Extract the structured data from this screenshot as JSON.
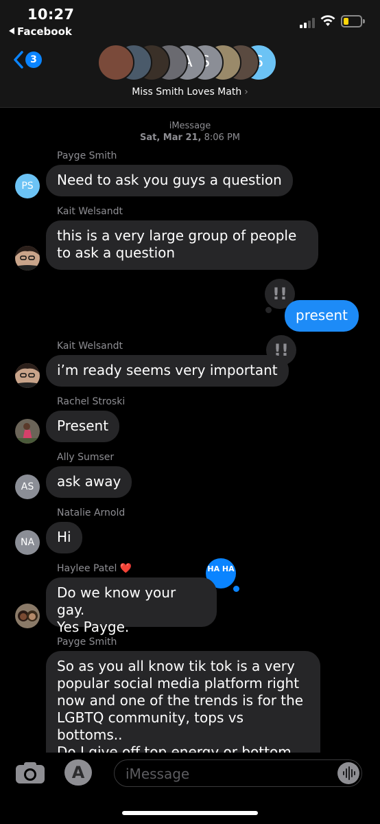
{
  "status_bar": {
    "time": "10:27",
    "back_app": "Facebook",
    "battery_color": "#ffd60a"
  },
  "nav": {
    "unread_count": "3",
    "group_name": "Miss Smith Loves Math",
    "group_chevron": "›",
    "group_avatars": [
      {
        "initials": "",
        "color": "#7a4a3a"
      },
      {
        "initials": "",
        "color": "#4a5a6a"
      },
      {
        "initials": "",
        "color": "#3a3028"
      },
      {
        "initials": "",
        "color": "#6a6a70"
      },
      {
        "initials": "A",
        "color": "#8b8e96"
      },
      {
        "initials": "S",
        "color": "#8b8e96"
      },
      {
        "initials": "",
        "color": "#9a8a6a"
      },
      {
        "initials": "",
        "color": "#5a4a40"
      },
      {
        "initials": "S",
        "color": "#6cc3f5"
      }
    ]
  },
  "conversation": {
    "service": "iMessage",
    "date": "Sat, Mar 21,",
    "time": "8:06 PM",
    "messages": [
      {
        "sender": "Payge Smith",
        "text": "Need to ask you guys a question",
        "avatar": "PS"
      },
      {
        "sender": "Kait Welsandt",
        "text": "this is a very large group of people to ask a question",
        "avatar": "photo"
      },
      {
        "sender": "",
        "text": "present",
        "outgoing": true,
        "tapback": "!!"
      },
      {
        "sender": "Kait Welsandt",
        "text": "i’m ready seems very important",
        "avatar": "photo",
        "tapback": "!!"
      },
      {
        "sender": "Rachel Stroski",
        "text": "Present",
        "avatar": "photo"
      },
      {
        "sender": "Ally Sumser",
        "text": "ask away",
        "avatar": "AS"
      },
      {
        "sender": "Natalie Arnold",
        "text": "Hi",
        "avatar": "NA"
      },
      {
        "sender": "Haylee Patel ❤️",
        "text": "Do we know your gay.\nYes Payge.",
        "avatar": "photo",
        "tapback": "HA HA"
      },
      {
        "sender": "Payge Smith",
        "text": "So as you all know tik tok is a very\npopular social media platform right\nnow and one of the trends is for the\nLGBTQ community, tops vs bottoms..\nDo I give off top energy or bottom\nenergy? I have a few opinions already",
        "avatar": "PS"
      }
    ]
  },
  "input": {
    "placeholder": "iMessage"
  }
}
